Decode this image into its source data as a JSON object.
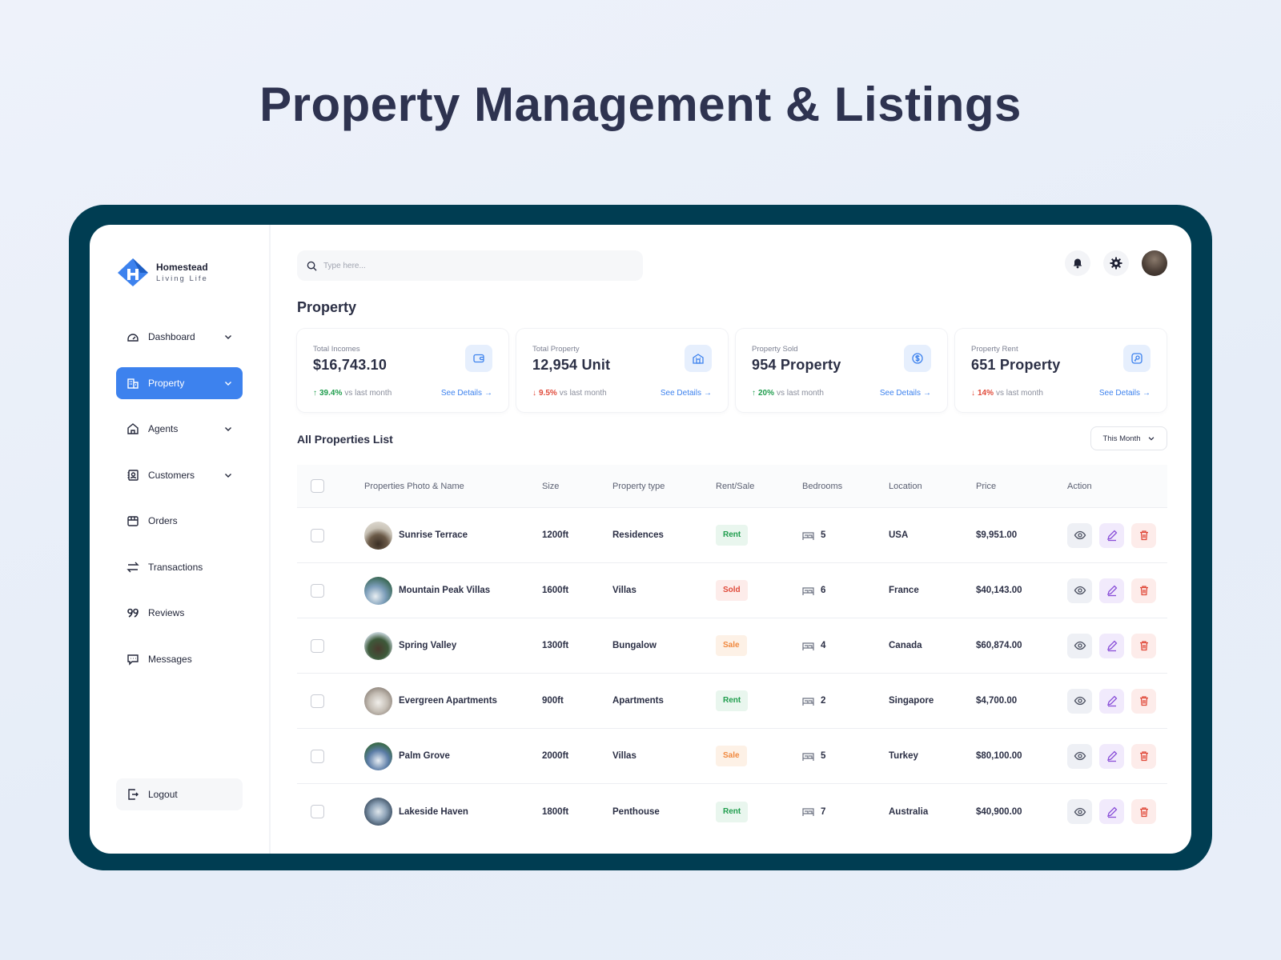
{
  "hero": {
    "title": "Property Management & Listings"
  },
  "brand": {
    "name": "Homestead",
    "tagline": "Living Life"
  },
  "sidebar": {
    "items": [
      {
        "label": "Dashboard",
        "icon": "dashboard-icon",
        "chevron": true,
        "active": false
      },
      {
        "label": "Property",
        "icon": "property-icon",
        "chevron": true,
        "active": true
      },
      {
        "label": "Agents",
        "icon": "home-icon",
        "chevron": true,
        "active": false
      },
      {
        "label": "Customers",
        "icon": "contact-icon",
        "chevron": true,
        "active": false
      },
      {
        "label": "Orders",
        "icon": "orders-icon",
        "chevron": false,
        "active": false
      },
      {
        "label": "Transactions",
        "icon": "transfer-icon",
        "chevron": false,
        "active": false
      },
      {
        "label": "Reviews",
        "icon": "quote-icon",
        "chevron": false,
        "active": false
      },
      {
        "label": "Messages",
        "icon": "chat-icon",
        "chevron": false,
        "active": false
      }
    ],
    "logout_label": "Logout"
  },
  "search": {
    "placeholder": "Type here..."
  },
  "page": {
    "title": "Property"
  },
  "stats": [
    {
      "label": "Total Incomes",
      "value": "$16,743.10",
      "trend": "up",
      "pct": "39.4%",
      "suffix": "vs last month",
      "link": "See Details",
      "icon": "wallet-icon"
    },
    {
      "label": "Total Property",
      "value": "12,954 Unit",
      "trend": "down",
      "pct": "9.5%",
      "suffix": "vs last month",
      "link": "See Details",
      "icon": "building-icon"
    },
    {
      "label": "Property Sold",
      "value": "954 Property",
      "trend": "up",
      "pct": "20%",
      "suffix": "vs last month",
      "link": "See Details",
      "icon": "dollar-icon"
    },
    {
      "label": "Property Rent",
      "value": "651 Property",
      "trend": "down",
      "pct": "14%",
      "suffix": "vs last month",
      "link": "See Details",
      "icon": "key-icon"
    }
  ],
  "list": {
    "title": "All Properties List",
    "filter_label": "This Month",
    "columns": [
      "Properties Photo & Name",
      "Size",
      "Property type",
      "Rent/Sale",
      "Bedrooms",
      "Location",
      "Price",
      "Action"
    ],
    "rows": [
      {
        "name": "Sunrise Terrace",
        "size": "1200ft",
        "type": "Residences",
        "status": "Rent",
        "bedrooms": "5",
        "location": "USA",
        "price": "$9,951.00"
      },
      {
        "name": "Mountain Peak Villas",
        "size": "1600ft",
        "type": "Villas",
        "status": "Sold",
        "bedrooms": "6",
        "location": "France",
        "price": "$40,143.00"
      },
      {
        "name": "Spring Valley",
        "size": "1300ft",
        "type": "Bungalow",
        "status": "Sale",
        "bedrooms": "4",
        "location": "Canada",
        "price": "$60,874.00"
      },
      {
        "name": "Evergreen Apartments",
        "size": "900ft",
        "type": "Apartments",
        "status": "Rent",
        "bedrooms": "2",
        "location": "Singapore",
        "price": "$4,700.00"
      },
      {
        "name": "Palm Grove",
        "size": "2000ft",
        "type": "Villas",
        "status": "Sale",
        "bedrooms": "5",
        "location": "Turkey",
        "price": "$80,100.00"
      },
      {
        "name": "Lakeside Haven",
        "size": "1800ft",
        "type": "Penthouse",
        "status": "Rent",
        "bedrooms": "7",
        "location": "Australia",
        "price": "$40,900.00"
      }
    ]
  },
  "colors": {
    "accent": "#3d82ee",
    "frame": "#003d52",
    "up": "#1f9d4d",
    "down": "#e04a3a",
    "sale": "#f0883e"
  }
}
